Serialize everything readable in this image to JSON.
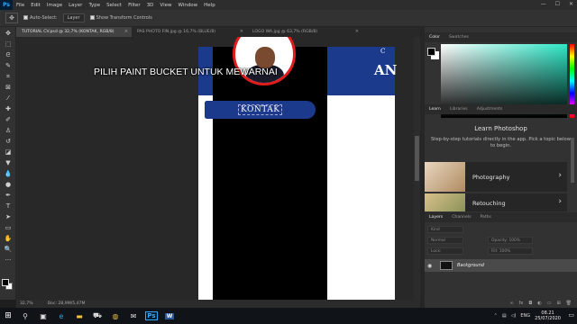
{
  "menubar": {
    "logo": "Ps",
    "items": [
      "File",
      "Edit",
      "Image",
      "Layer",
      "Type",
      "Select",
      "Filter",
      "3D",
      "View",
      "Window",
      "Help"
    ],
    "window_controls": [
      "—",
      "☐",
      "✕"
    ]
  },
  "options": {
    "auto_select_label": "Auto-Select:",
    "auto_select_value": "Layer",
    "show_transform_label": "Show Transform Controls"
  },
  "tabs": [
    {
      "label": "TUTORIAL CV.psd @ 32,7% (KONTAK, RGB/8)",
      "active": true
    },
    {
      "label": "PAS PHOTO FIN.jpg @ 16,7% (BLUE/8)",
      "active": false
    },
    {
      "label": "LOGO WA.jpg @ 63,7% (RGB/8)",
      "active": false
    }
  ],
  "canvas": {
    "overlay_caption": "PILIH PAINT BUCKET UNTUK MEWARNAI",
    "kontak_text": "KONTAK",
    "blue_header_big": "AN",
    "blue_header_small": "C",
    "colors": {
      "dark_blue": "#1b3a8c",
      "photo_ring": "#e21c1c"
    }
  },
  "status": {
    "zoom": "32,7%",
    "doc": "Doc: 28,9M/5,47M"
  },
  "panels": {
    "color_tabs": [
      "Color",
      "Swatches"
    ],
    "learn_tabs": [
      "Learn",
      "Libraries",
      "Adjustments"
    ],
    "learn_title": "Learn Photoshop",
    "learn_desc": "Step-by-step tutorials directly in the app. Pick a topic below to begin.",
    "cards": [
      {
        "label": "Photography",
        "icon": "photography-thumb"
      },
      {
        "label": "Retouching",
        "icon": "retouching-thumb"
      }
    ],
    "layers_tabs": [
      "Layers",
      "Channels",
      "Paths"
    ],
    "filter_placeholder": "Kind",
    "blend_mode": "Normal",
    "opacity": "Opacity: 100%",
    "lock": "Lock:",
    "fill": "Fill: 100%",
    "layer_name": "Background"
  },
  "taskbar": {
    "time": "08.21",
    "date": "25/07/2020",
    "lang": "ENG"
  }
}
